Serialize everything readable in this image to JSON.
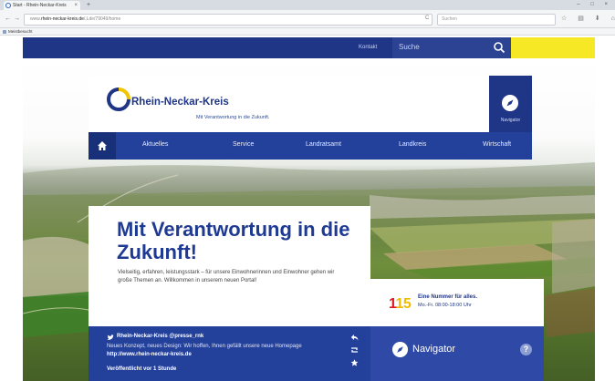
{
  "browser": {
    "tab_title": "Start - Rhein-Neckar-Kreis",
    "tab_close": "×",
    "new_tab": "+",
    "window_controls": "– □ ×",
    "back": "←",
    "forward": "→",
    "url_prefix": "www.",
    "url_domain": "rhein-neckar-kreis.de",
    "url_suffix": "/,Lde/79049/home",
    "reload": "C",
    "search_placeholder": "Suchen",
    "tools": "☆ ▤ ⬇ ⌂ ≡",
    "bookmark": "Meistbesucht"
  },
  "topbar": {
    "kontakt": "Kontakt",
    "search_label": "Suche"
  },
  "logo": {
    "name": "Rhein-Neckar-Kreis",
    "tagline": "Mit Verantwortung in die Zukunft."
  },
  "navigator_button": {
    "label": "Navigator"
  },
  "mainnav": {
    "items": [
      "Aktuelles",
      "Service",
      "Landratsamt",
      "Landkreis",
      "Wirtschaft"
    ]
  },
  "headline": {
    "title": "Mit Verantwortung in die Zukunft!",
    "body": "Vielseitig, erfahren, leistungsstark – für unsere Einwohnerinnen und Einwohner gehen wir große Themen an. Willkommen in unserem neuen Portal!"
  },
  "service_115": {
    "number_first": "1",
    "number_rest": "15",
    "title": "Eine Nummer für alles.",
    "hours": "Mo.-Fr. 08:00-18:00 Uhr"
  },
  "tweet": {
    "handle": "Rhein-Neckar-Kreis @presse_rnk",
    "text": "Neues Konzept, neues Design: Wir hoffen, Ihnen gefällt unsere neue Homepage",
    "link": "http://www.rhein-neckar-kreis.de",
    "time": "Veröffentlicht vor 1 Stunde"
  },
  "navigator_panel": {
    "label": "Navigator",
    "help": "?"
  },
  "colors": {
    "brand_blue": "#1f3586",
    "nav_blue": "#23409a",
    "accent_yellow": "#f6e824",
    "red": "#e1191e"
  }
}
